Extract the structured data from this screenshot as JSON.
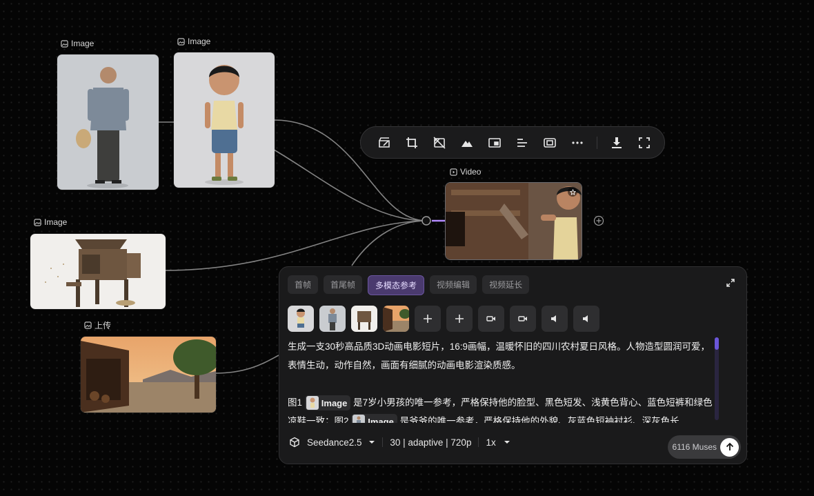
{
  "nodes": {
    "image1_label": "Image",
    "image2_label": "Image",
    "image3_label": "Image",
    "upload_label": "上传",
    "video_label": "Video"
  },
  "toolbar": {
    "icons": [
      "edit-icon",
      "crop-icon",
      "remove-background-icon",
      "landscape-icon",
      "picture-in-picture-icon",
      "align-icon",
      "screen-icon",
      "more-icon",
      "download-icon",
      "fullscreen-icon"
    ]
  },
  "panel": {
    "tabs": [
      "首帧",
      "首尾帧",
      "多模态参考",
      "视频编辑",
      "视频延长"
    ],
    "active_tab": "多模态参考",
    "prompt": {
      "p1": "生成一支30秒高品质3D动画电影短片，16:9画幅，温暖怀旧的四川农村夏日风格。人物造型圆润可爱，表情生动，动作自然，画面有细腻的动画电影渲染质感。",
      "l2a": "图1",
      "chip1": "Image",
      "l2b": "是7岁小男孩的唯一参考，严格保持他的脸型、黑色短发、浅黄色背心、蓝色短裤和绿色凉鞋一致；图2",
      "chip2": "Image",
      "l2c": "是爷爷的唯一参考，严格保持他的外貌、灰蓝色短袖衬衫、深灰色长"
    },
    "footer": {
      "model": "Seedance2.5",
      "settings": "30 | adaptive | 720p",
      "multiplier": "1x"
    },
    "send_label": "6116 Muses"
  },
  "colors": {
    "accent": "#6b56d8",
    "tab_active": "#4a3a6e"
  }
}
